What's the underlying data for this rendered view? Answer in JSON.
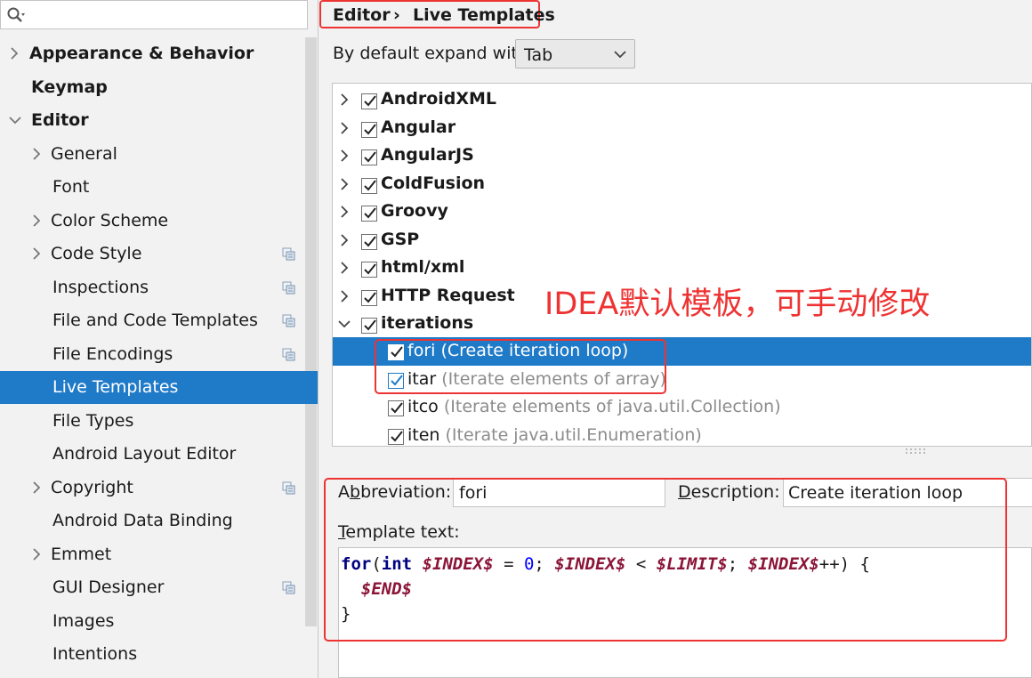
{
  "search": {
    "placeholder": ""
  },
  "nav": {
    "items": [
      {
        "label": "Appearance & Behavior",
        "bold": true
      },
      {
        "label": "Keymap",
        "bold": true
      },
      {
        "label": "Editor",
        "bold": true
      },
      {
        "label": "General"
      },
      {
        "label": "Font"
      },
      {
        "label": "Color Scheme"
      },
      {
        "label": "Code Style"
      },
      {
        "label": "Inspections"
      },
      {
        "label": "File and Code Templates"
      },
      {
        "label": "File Encodings"
      },
      {
        "label": "Live Templates",
        "selected": true
      },
      {
        "label": "File Types"
      },
      {
        "label": "Android Layout Editor"
      },
      {
        "label": "Copyright"
      },
      {
        "label": "Android Data Binding"
      },
      {
        "label": "Emmet"
      },
      {
        "label": "GUI Designer"
      },
      {
        "label": "Images"
      },
      {
        "label": "Intentions"
      }
    ]
  },
  "breadcrumb": {
    "parent": "Editor",
    "separator": "›",
    "current": "Live Templates"
  },
  "expand": {
    "label": "By default expand with",
    "value": "Tab"
  },
  "groups": [
    {
      "name": "AndroidXML",
      "checked": true
    },
    {
      "name": "Angular",
      "checked": true
    },
    {
      "name": "AngularJS",
      "checked": true
    },
    {
      "name": "ColdFusion",
      "checked": true
    },
    {
      "name": "Groovy",
      "checked": true
    },
    {
      "name": "GSP",
      "checked": true
    },
    {
      "name": "html/xml",
      "checked": true
    },
    {
      "name": "HTTP Request",
      "checked": true
    },
    {
      "name": "iterations",
      "checked": true,
      "expanded": true
    }
  ],
  "templates": [
    {
      "abbr": "fori",
      "desc": "(Create iteration loop)",
      "selected": true
    },
    {
      "abbr": "itar",
      "desc": "(Iterate elements of array)"
    },
    {
      "abbr": "itco",
      "desc": "(Iterate elements of java.util.Collection)"
    },
    {
      "abbr": "iten",
      "desc": "(Iterate java.util.Enumeration)"
    }
  ],
  "annotation": "IDEA默认模板，可手动修改",
  "editor": {
    "abbr_label_pre": "A",
    "abbr_label_ul": "b",
    "abbr_label_post": "breviation:",
    "abbr_value": "fori",
    "desc_label_ul": "D",
    "desc_label_post": "escription:",
    "desc_value": "Create iteration loop",
    "tt_label_ul": "T",
    "tt_label_post": "emplate text:",
    "code": {
      "kw_for": "for",
      "paren_open": "(",
      "kw_int": "int",
      "space1": " ",
      "var_index": "$INDEX$",
      "assign": " = ",
      "zero": "0",
      "semi1": "; ",
      "lt": " < ",
      "var_limit": "$LIMIT$",
      "semi2": "; ",
      "inc": "++) {",
      "indent": "  ",
      "var_end": "$END$",
      "close": "}"
    }
  },
  "colors": {
    "accent": "#1f7ac8",
    "annotation": "#ee3333"
  }
}
